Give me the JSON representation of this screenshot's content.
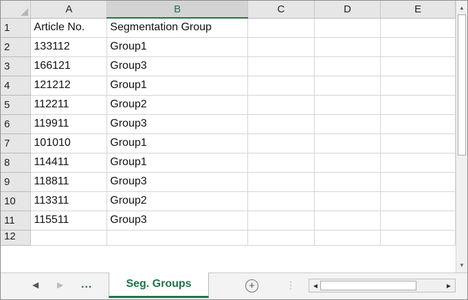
{
  "columns": [
    "A",
    "B",
    "C",
    "D",
    "E"
  ],
  "selected_column": "B",
  "header_row": {
    "num": "1",
    "a": "Article No.",
    "b": "Segmentation Group"
  },
  "rows": [
    {
      "num": "2",
      "a": "133112",
      "b": "Group1"
    },
    {
      "num": "3",
      "a": "166121",
      "b": "Group3"
    },
    {
      "num": "4",
      "a": "121212",
      "b": "Group1"
    },
    {
      "num": "5",
      "a": "112211",
      "b": "Group2"
    },
    {
      "num": "6",
      "a": "119911",
      "b": "Group3"
    },
    {
      "num": "7",
      "a": "101010",
      "b": "Group1"
    },
    {
      "num": "8",
      "a": "114411",
      "b": "Group1"
    },
    {
      "num": "9",
      "a": "118811",
      "b": "Group3"
    },
    {
      "num": "10",
      "a": "113311",
      "b": "Group2"
    },
    {
      "num": "11",
      "a": "115511",
      "b": "Group3"
    }
  ],
  "last_row_num": "12",
  "tabbar": {
    "prev_icon": "triangle-left",
    "next_icon": "triangle-right",
    "more_label": "...",
    "active_sheet": "Seg. Groups",
    "add_icon": "plus-circle"
  },
  "accent_color": "#217346"
}
